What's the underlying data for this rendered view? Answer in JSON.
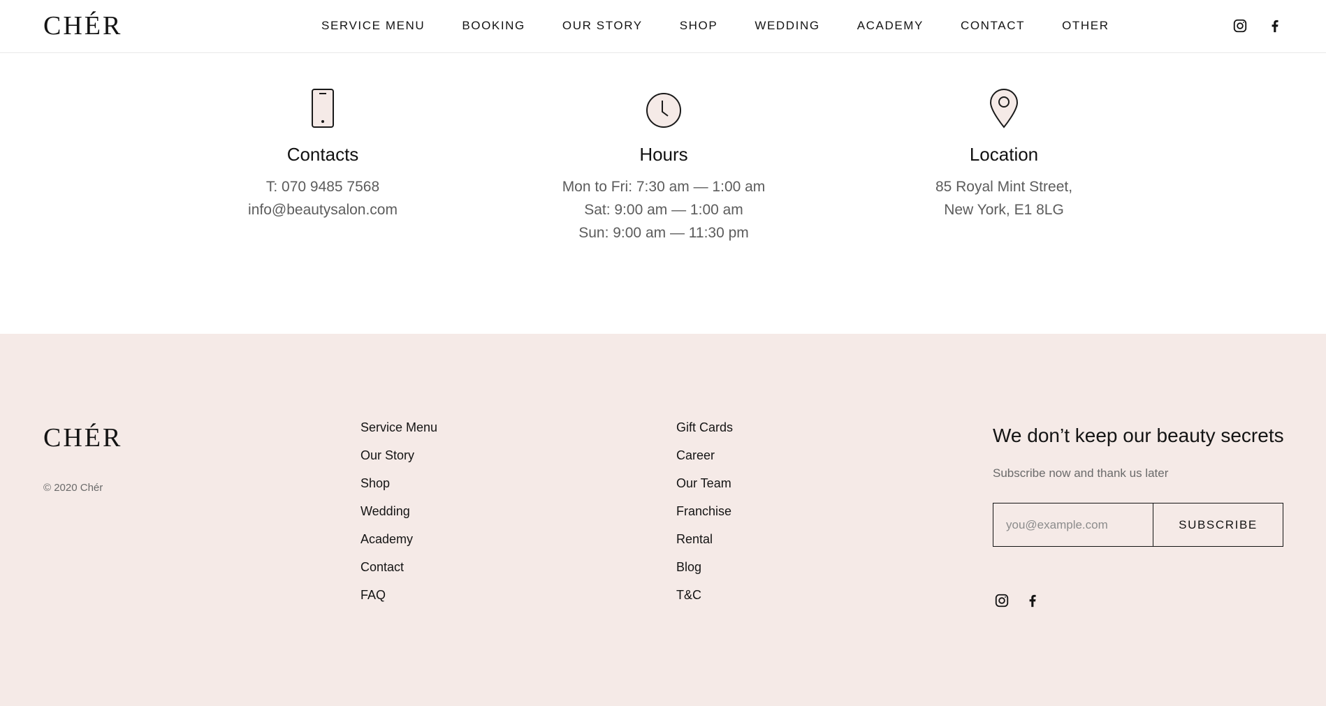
{
  "brand": {
    "logo": "CHÉR",
    "copyright": "© 2020 Chér"
  },
  "nav": {
    "items": [
      "SERVICE MENU",
      "BOOKING",
      "OUR STORY",
      "SHOP",
      "WEDDING",
      "ACADEMY",
      "CONTACT",
      "OTHER"
    ]
  },
  "social": {
    "icons": [
      "instagram-icon",
      "facebook-icon"
    ]
  },
  "info": {
    "contacts": {
      "title": "Contacts",
      "lines": [
        "T: 070 9485 7568",
        "info@beautysalon.com"
      ],
      "icon": "phone-icon"
    },
    "hours": {
      "title": "Hours",
      "lines": [
        "Mon to Fri: 7:30 am — 1:00 am",
        "Sat: 9:00 am — 1:00 am",
        "Sun: 9:00 am — 11:30 pm"
      ],
      "icon": "clock-icon"
    },
    "location": {
      "title": "Location",
      "lines": [
        "85 Royal Mint Street,",
        "New York, E1 8LG"
      ],
      "icon": "map-pin-icon"
    }
  },
  "footer": {
    "links_col1": [
      "Service Menu",
      "Our Story",
      "Shop",
      "Wedding",
      "Academy",
      "Contact",
      "FAQ"
    ],
    "links_col2": [
      "Gift Cards",
      "Career",
      "Our Team",
      "Franchise",
      "Rental",
      "Blog",
      "T&C"
    ],
    "newsletter": {
      "title": "We don’t keep our beauty secrets",
      "subtitle": "Subscribe now and thank us later",
      "placeholder": "you@example.com",
      "button": "SUBSCRIBE"
    }
  },
  "colors": {
    "footer_bg": "#f5eae7",
    "icon_fill": "#f5eae7",
    "text": "#141414",
    "muted": "#5c5c5c"
  }
}
